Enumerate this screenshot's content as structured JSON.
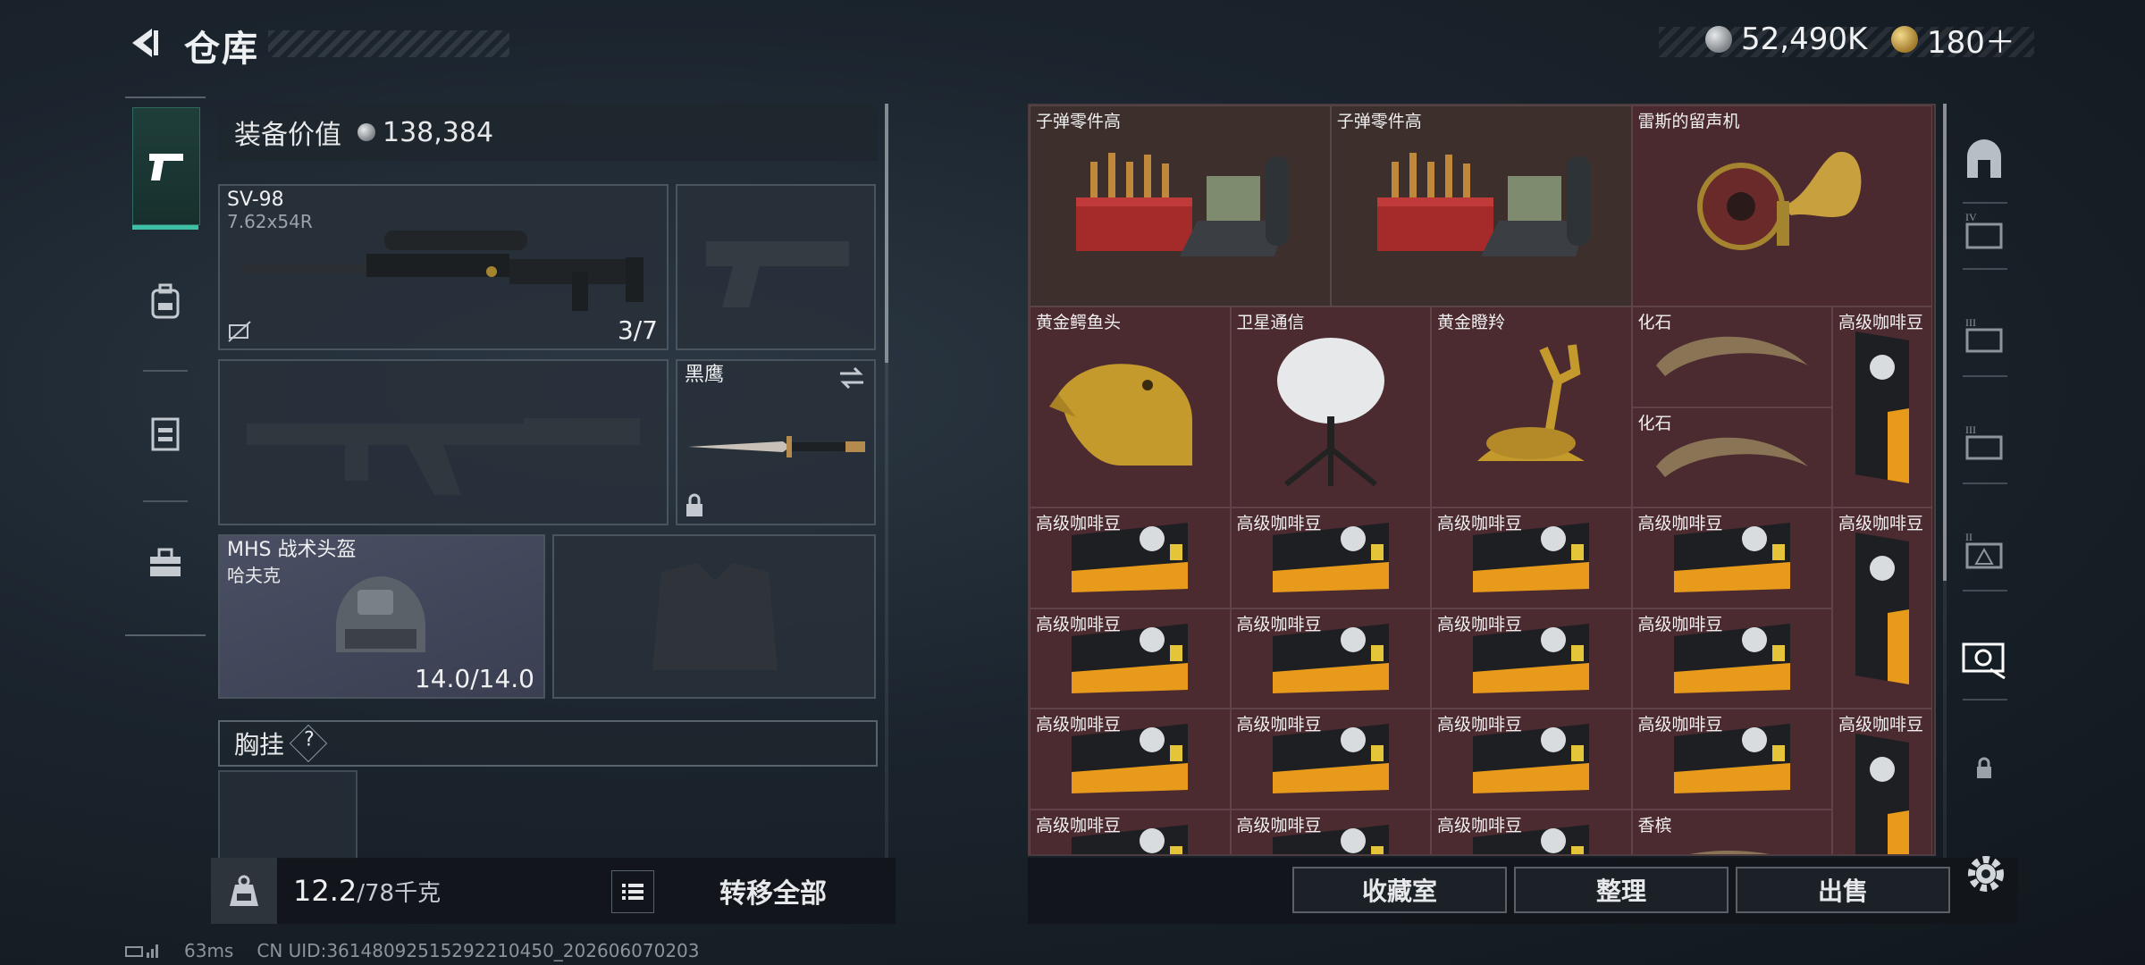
{
  "header": {
    "title": "仓库"
  },
  "currency": {
    "silver": "52,490K",
    "gold": "180＋"
  },
  "equipment": {
    "value_label": "装备价值",
    "value": "138,384",
    "primary": {
      "name": "SV-98",
      "ammo": "7.62x54R",
      "count": "3/7"
    },
    "melee": {
      "name": "黑鹰"
    },
    "helmet": {
      "name": "MHS 战术头盔",
      "sub": "哈夫克",
      "durability": "14.0/14.0"
    },
    "chest_label": "胸挂",
    "chest_help": "?"
  },
  "footer": {
    "weight": "12.2",
    "weight_max": "/78千克",
    "transfer": "转移全部"
  },
  "status": {
    "ping": "63ms",
    "uid": "CN UID:36148092515292210450_202606070203"
  },
  "grid": {
    "items": [
      {
        "label": "子弹零件高",
        "kind": "ammo"
      },
      {
        "label": "子弹零件高",
        "kind": "ammo"
      },
      {
        "label": "雷斯的留声机",
        "kind": "gramophone"
      },
      {
        "label": "黄金鳄鱼头",
        "kind": "croc"
      },
      {
        "label": "卫星通信",
        "kind": "satellite"
      },
      {
        "label": "黄金瞪羚",
        "kind": "gazelle"
      },
      {
        "label": "化石",
        "kind": "fossil"
      },
      {
        "label": "化石",
        "kind": "fossil"
      },
      {
        "label": "高级咖啡豆",
        "kind": "coffee-tall"
      },
      {
        "label": "高级咖啡豆",
        "kind": "coffee"
      },
      {
        "label": "高级咖啡豆",
        "kind": "coffee"
      },
      {
        "label": "高级咖啡豆",
        "kind": "coffee"
      },
      {
        "label": "高级咖啡豆",
        "kind": "coffee"
      },
      {
        "label": "高级咖啡豆",
        "kind": "coffee-tall"
      },
      {
        "label": "高级咖啡豆",
        "kind": "coffee"
      },
      {
        "label": "高级咖啡豆",
        "kind": "coffee"
      },
      {
        "label": "高级咖啡豆",
        "kind": "coffee"
      },
      {
        "label": "高级咖啡豆",
        "kind": "coffee"
      },
      {
        "label": "高级咖啡豆",
        "kind": "coffee"
      },
      {
        "label": "高级咖啡豆",
        "kind": "coffee"
      },
      {
        "label": "高级咖啡豆",
        "kind": "coffee"
      },
      {
        "label": "高级咖啡豆",
        "kind": "coffee"
      },
      {
        "label": "高级咖啡豆",
        "kind": "coffee-tall"
      },
      {
        "label": "高级咖啡豆",
        "kind": "coffee"
      },
      {
        "label": "高级咖啡豆",
        "kind": "coffee"
      },
      {
        "label": "高级咖啡豆",
        "kind": "coffee"
      },
      {
        "label": "香槟",
        "kind": "champagne"
      }
    ]
  },
  "actions": {
    "collection": "收藏室",
    "organize": "整理",
    "sell": "出售"
  }
}
